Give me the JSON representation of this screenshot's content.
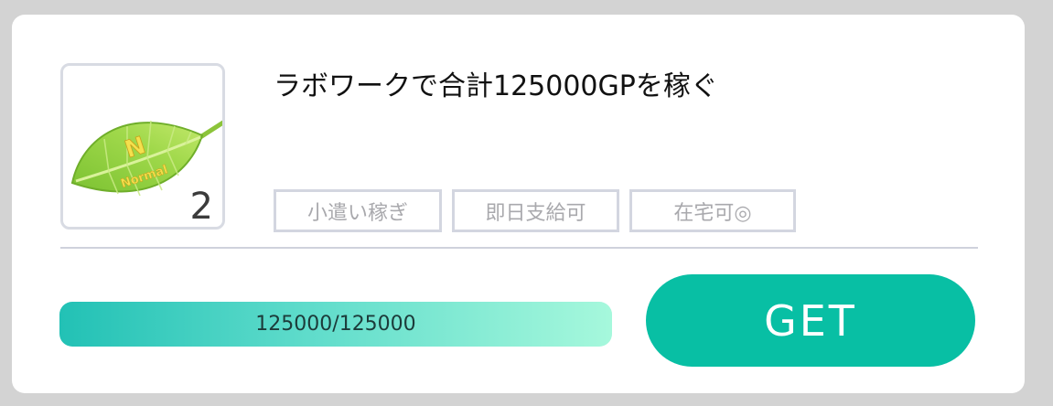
{
  "mission": {
    "title": "ラボワークで合計125000GPを稼ぐ",
    "level": "2",
    "badge_text": "Normal",
    "badge_letter": "N",
    "tags": [
      "小遣い稼ぎ",
      "即日支給可",
      "在宅可◎"
    ],
    "progress": {
      "current": 125000,
      "goal": 125000,
      "label": "125000/125000"
    },
    "action_label": "GET"
  },
  "icons": {
    "badge": "leaf-icon"
  },
  "colors": {
    "accent": "#08bfa4",
    "progress_start": "#22c1b5",
    "progress_end": "#a6f8dc",
    "leaf": "#8ccf3a",
    "badge_text": "#f4e04d"
  }
}
